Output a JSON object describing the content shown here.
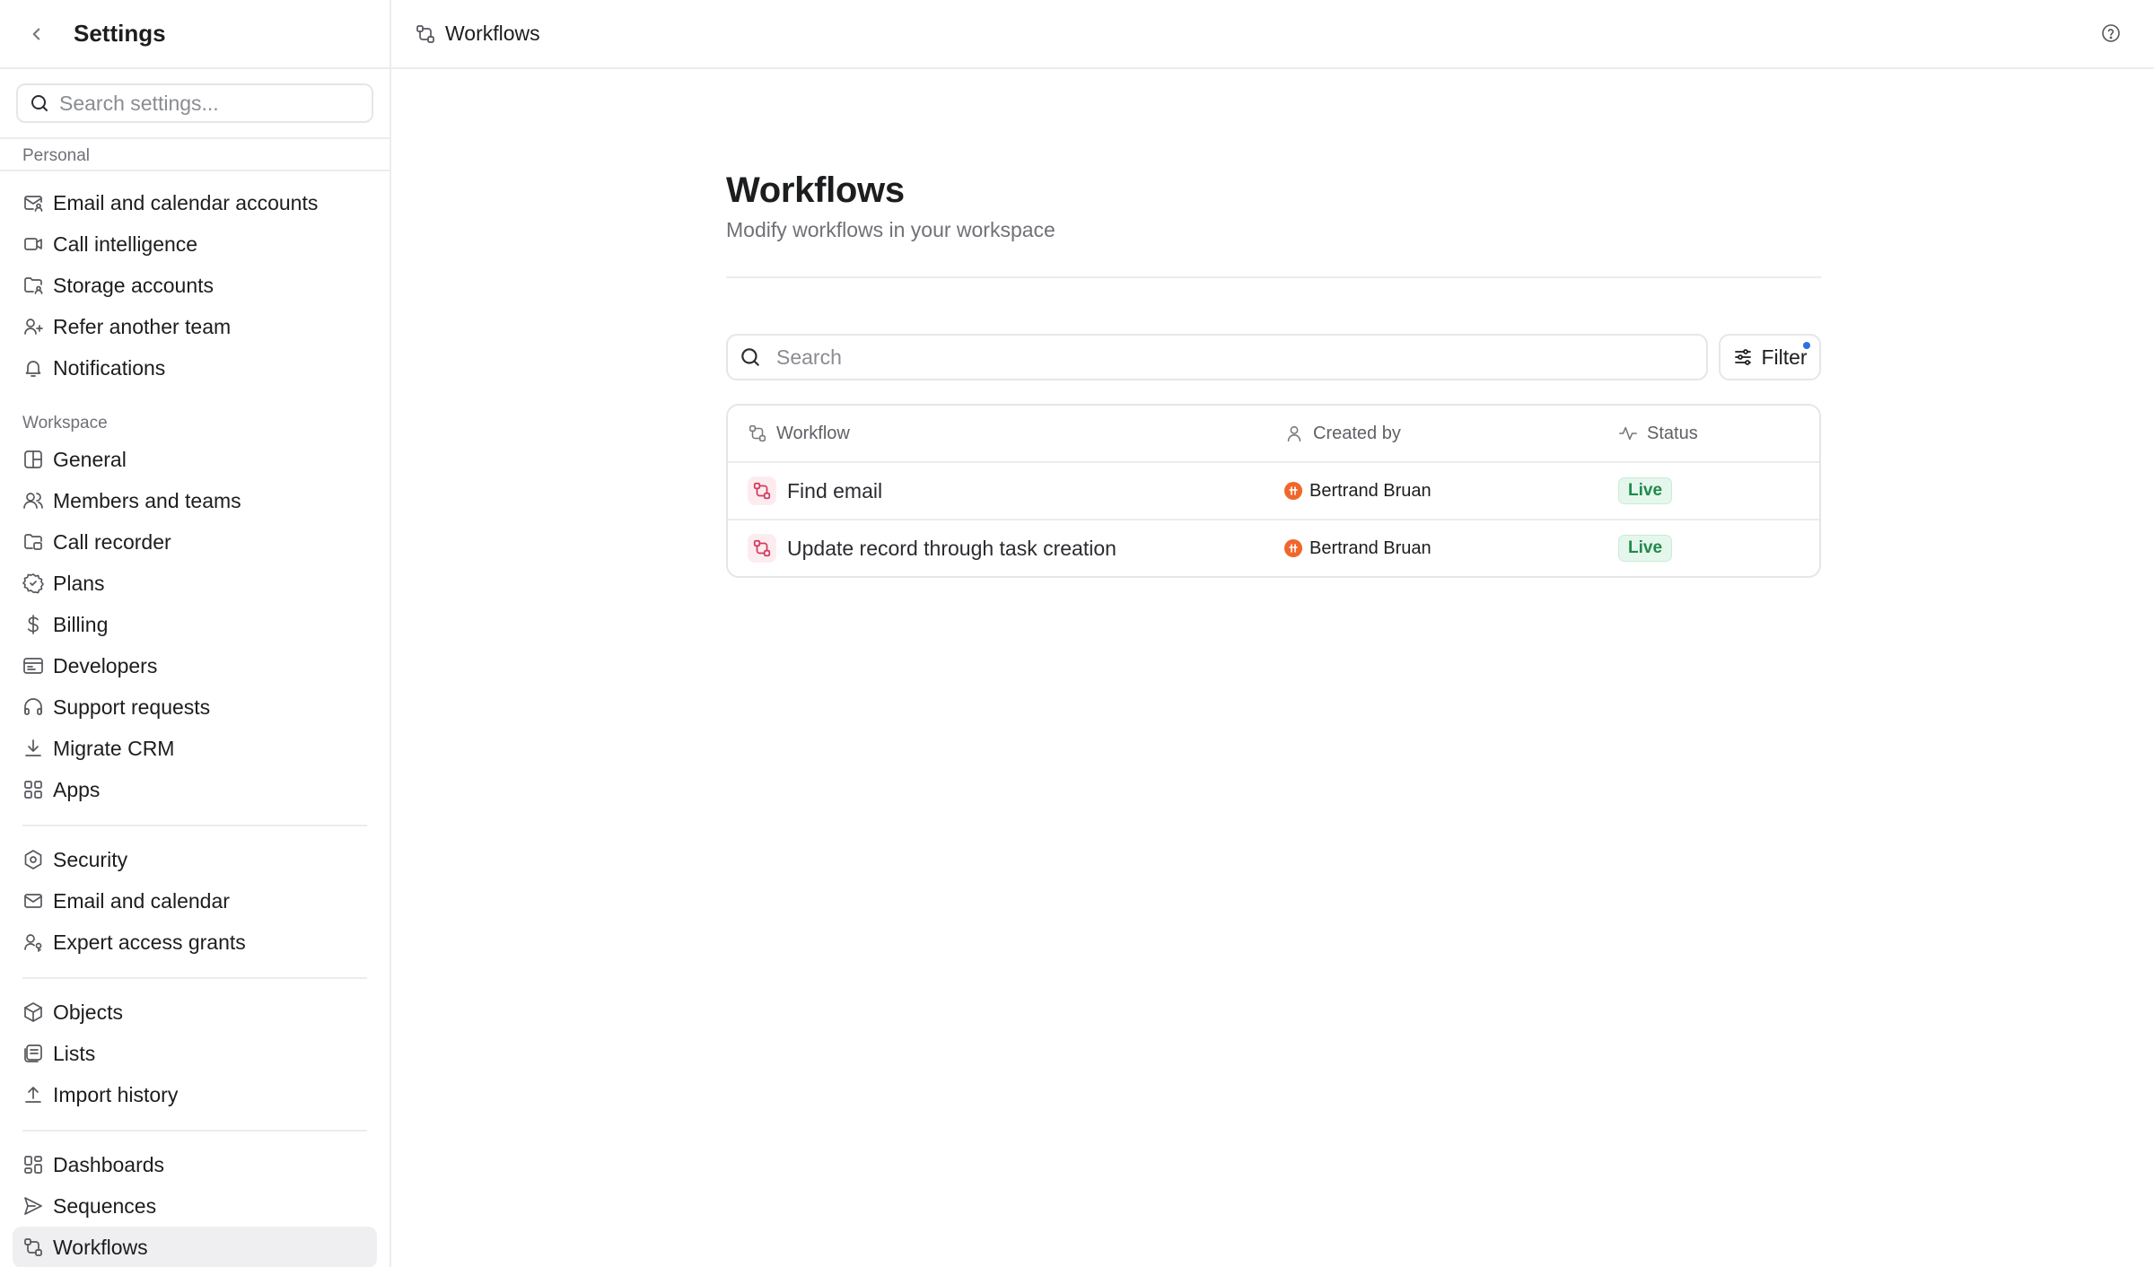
{
  "sidebar": {
    "title": "Settings",
    "search_placeholder": "Search settings...",
    "sections": {
      "personal": {
        "label": "Personal",
        "items": [
          {
            "label": "Email and calendar accounts"
          },
          {
            "label": "Call intelligence"
          },
          {
            "label": "Storage accounts"
          },
          {
            "label": "Refer another team"
          },
          {
            "label": "Notifications"
          }
        ]
      },
      "workspace": {
        "label": "Workspace",
        "group1": [
          {
            "label": "General"
          },
          {
            "label": "Members and teams"
          },
          {
            "label": "Call recorder"
          },
          {
            "label": "Plans"
          },
          {
            "label": "Billing"
          },
          {
            "label": "Developers"
          },
          {
            "label": "Support requests"
          },
          {
            "label": "Migrate CRM"
          },
          {
            "label": "Apps"
          }
        ],
        "group2": [
          {
            "label": "Security"
          },
          {
            "label": "Email and calendar"
          },
          {
            "label": "Expert access grants"
          }
        ],
        "group3": [
          {
            "label": "Objects"
          },
          {
            "label": "Lists"
          },
          {
            "label": "Import history"
          }
        ],
        "group4": [
          {
            "label": "Dashboards"
          },
          {
            "label": "Sequences"
          },
          {
            "label": "Workflows"
          }
        ]
      }
    }
  },
  "topbar": {
    "breadcrumb": "Workflows"
  },
  "main": {
    "title": "Workflows",
    "subtitle": "Modify workflows in your workspace",
    "search_placeholder": "Search",
    "filter_label": "Filter",
    "table": {
      "columns": {
        "workflow": "Workflow",
        "created_by": "Created by",
        "status": "Status"
      },
      "rows": [
        {
          "name": "Find email",
          "created_by": "Bertrand Bruan",
          "status": "Live"
        },
        {
          "name": "Update record through task creation",
          "created_by": "Bertrand Bruan",
          "status": "Live"
        }
      ]
    }
  },
  "colors": {
    "accent_blue": "#2f6ee7",
    "live_green": "#1f8a4c",
    "workflow_icon_pink": "#d33a5c",
    "avatar_orange": "#f0672b"
  }
}
